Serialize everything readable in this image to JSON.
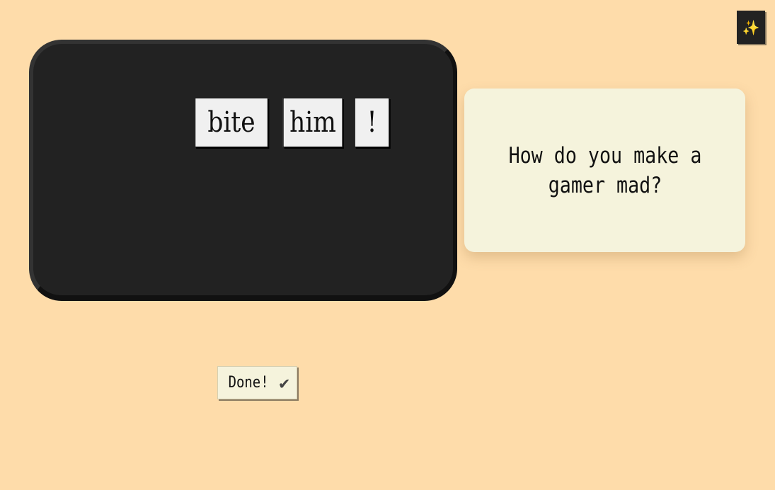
{
  "toolbar": {
    "magic_icon": "✨",
    "magic_icon_name": "sparkles-icon"
  },
  "board": {
    "tiles": [
      "bite",
      "him",
      "!"
    ]
  },
  "prompt": {
    "text": "How do you make a gamer mad?"
  },
  "done_button": {
    "label": "Done!",
    "icon": "✔"
  },
  "colors": {
    "background": "#fedcaa",
    "board": "#222222",
    "tile": "#f0f0f0",
    "card": "#f5f3dc"
  }
}
